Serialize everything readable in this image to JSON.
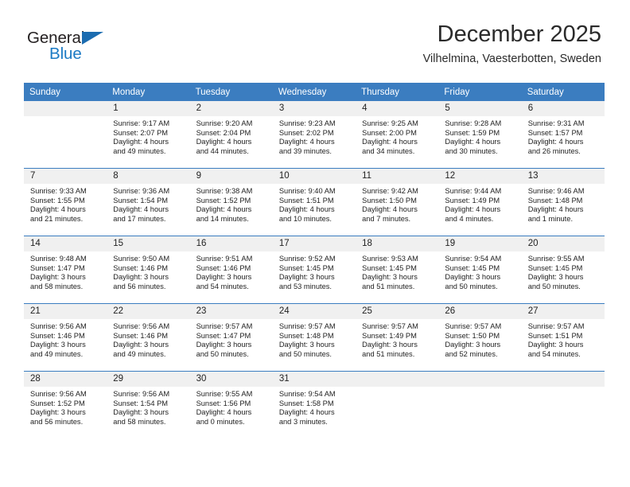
{
  "logo": {
    "word_one": "General",
    "word_two": "Blue",
    "triangle_color": "#1b6cb0",
    "blue_color": "#1b7ac4"
  },
  "header": {
    "title": "December 2025",
    "subtitle": "Vilhelmina, Vaesterbotten, Sweden",
    "header_bg": "#3b7dc0",
    "daynum_bg": "#f0f0f0"
  },
  "weekdays": [
    "Sunday",
    "Monday",
    "Tuesday",
    "Wednesday",
    "Thursday",
    "Friday",
    "Saturday"
  ],
  "weeks": [
    [
      {
        "day": "",
        "sunrise": "",
        "sunset": "",
        "daylight_line1": "",
        "daylight_line2": ""
      },
      {
        "day": "1",
        "sunrise": "Sunrise: 9:17 AM",
        "sunset": "Sunset: 2:07 PM",
        "daylight_line1": "Daylight: 4 hours",
        "daylight_line2": "and 49 minutes."
      },
      {
        "day": "2",
        "sunrise": "Sunrise: 9:20 AM",
        "sunset": "Sunset: 2:04 PM",
        "daylight_line1": "Daylight: 4 hours",
        "daylight_line2": "and 44 minutes."
      },
      {
        "day": "3",
        "sunrise": "Sunrise: 9:23 AM",
        "sunset": "Sunset: 2:02 PM",
        "daylight_line1": "Daylight: 4 hours",
        "daylight_line2": "and 39 minutes."
      },
      {
        "day": "4",
        "sunrise": "Sunrise: 9:25 AM",
        "sunset": "Sunset: 2:00 PM",
        "daylight_line1": "Daylight: 4 hours",
        "daylight_line2": "and 34 minutes."
      },
      {
        "day": "5",
        "sunrise": "Sunrise: 9:28 AM",
        "sunset": "Sunset: 1:59 PM",
        "daylight_line1": "Daylight: 4 hours",
        "daylight_line2": "and 30 minutes."
      },
      {
        "day": "6",
        "sunrise": "Sunrise: 9:31 AM",
        "sunset": "Sunset: 1:57 PM",
        "daylight_line1": "Daylight: 4 hours",
        "daylight_line2": "and 26 minutes."
      }
    ],
    [
      {
        "day": "7",
        "sunrise": "Sunrise: 9:33 AM",
        "sunset": "Sunset: 1:55 PM",
        "daylight_line1": "Daylight: 4 hours",
        "daylight_line2": "and 21 minutes."
      },
      {
        "day": "8",
        "sunrise": "Sunrise: 9:36 AM",
        "sunset": "Sunset: 1:54 PM",
        "daylight_line1": "Daylight: 4 hours",
        "daylight_line2": "and 17 minutes."
      },
      {
        "day": "9",
        "sunrise": "Sunrise: 9:38 AM",
        "sunset": "Sunset: 1:52 PM",
        "daylight_line1": "Daylight: 4 hours",
        "daylight_line2": "and 14 minutes."
      },
      {
        "day": "10",
        "sunrise": "Sunrise: 9:40 AM",
        "sunset": "Sunset: 1:51 PM",
        "daylight_line1": "Daylight: 4 hours",
        "daylight_line2": "and 10 minutes."
      },
      {
        "day": "11",
        "sunrise": "Sunrise: 9:42 AM",
        "sunset": "Sunset: 1:50 PM",
        "daylight_line1": "Daylight: 4 hours",
        "daylight_line2": "and 7 minutes."
      },
      {
        "day": "12",
        "sunrise": "Sunrise: 9:44 AM",
        "sunset": "Sunset: 1:49 PM",
        "daylight_line1": "Daylight: 4 hours",
        "daylight_line2": "and 4 minutes."
      },
      {
        "day": "13",
        "sunrise": "Sunrise: 9:46 AM",
        "sunset": "Sunset: 1:48 PM",
        "daylight_line1": "Daylight: 4 hours",
        "daylight_line2": "and 1 minute."
      }
    ],
    [
      {
        "day": "14",
        "sunrise": "Sunrise: 9:48 AM",
        "sunset": "Sunset: 1:47 PM",
        "daylight_line1": "Daylight: 3 hours",
        "daylight_line2": "and 58 minutes."
      },
      {
        "day": "15",
        "sunrise": "Sunrise: 9:50 AM",
        "sunset": "Sunset: 1:46 PM",
        "daylight_line1": "Daylight: 3 hours",
        "daylight_line2": "and 56 minutes."
      },
      {
        "day": "16",
        "sunrise": "Sunrise: 9:51 AM",
        "sunset": "Sunset: 1:46 PM",
        "daylight_line1": "Daylight: 3 hours",
        "daylight_line2": "and 54 minutes."
      },
      {
        "day": "17",
        "sunrise": "Sunrise: 9:52 AM",
        "sunset": "Sunset: 1:45 PM",
        "daylight_line1": "Daylight: 3 hours",
        "daylight_line2": "and 53 minutes."
      },
      {
        "day": "18",
        "sunrise": "Sunrise: 9:53 AM",
        "sunset": "Sunset: 1:45 PM",
        "daylight_line1": "Daylight: 3 hours",
        "daylight_line2": "and 51 minutes."
      },
      {
        "day": "19",
        "sunrise": "Sunrise: 9:54 AM",
        "sunset": "Sunset: 1:45 PM",
        "daylight_line1": "Daylight: 3 hours",
        "daylight_line2": "and 50 minutes."
      },
      {
        "day": "20",
        "sunrise": "Sunrise: 9:55 AM",
        "sunset": "Sunset: 1:45 PM",
        "daylight_line1": "Daylight: 3 hours",
        "daylight_line2": "and 50 minutes."
      }
    ],
    [
      {
        "day": "21",
        "sunrise": "Sunrise: 9:56 AM",
        "sunset": "Sunset: 1:46 PM",
        "daylight_line1": "Daylight: 3 hours",
        "daylight_line2": "and 49 minutes."
      },
      {
        "day": "22",
        "sunrise": "Sunrise: 9:56 AM",
        "sunset": "Sunset: 1:46 PM",
        "daylight_line1": "Daylight: 3 hours",
        "daylight_line2": "and 49 minutes."
      },
      {
        "day": "23",
        "sunrise": "Sunrise: 9:57 AM",
        "sunset": "Sunset: 1:47 PM",
        "daylight_line1": "Daylight: 3 hours",
        "daylight_line2": "and 50 minutes."
      },
      {
        "day": "24",
        "sunrise": "Sunrise: 9:57 AM",
        "sunset": "Sunset: 1:48 PM",
        "daylight_line1": "Daylight: 3 hours",
        "daylight_line2": "and 50 minutes."
      },
      {
        "day": "25",
        "sunrise": "Sunrise: 9:57 AM",
        "sunset": "Sunset: 1:49 PM",
        "daylight_line1": "Daylight: 3 hours",
        "daylight_line2": "and 51 minutes."
      },
      {
        "day": "26",
        "sunrise": "Sunrise: 9:57 AM",
        "sunset": "Sunset: 1:50 PM",
        "daylight_line1": "Daylight: 3 hours",
        "daylight_line2": "and 52 minutes."
      },
      {
        "day": "27",
        "sunrise": "Sunrise: 9:57 AM",
        "sunset": "Sunset: 1:51 PM",
        "daylight_line1": "Daylight: 3 hours",
        "daylight_line2": "and 54 minutes."
      }
    ],
    [
      {
        "day": "28",
        "sunrise": "Sunrise: 9:56 AM",
        "sunset": "Sunset: 1:52 PM",
        "daylight_line1": "Daylight: 3 hours",
        "daylight_line2": "and 56 minutes."
      },
      {
        "day": "29",
        "sunrise": "Sunrise: 9:56 AM",
        "sunset": "Sunset: 1:54 PM",
        "daylight_line1": "Daylight: 3 hours",
        "daylight_line2": "and 58 minutes."
      },
      {
        "day": "30",
        "sunrise": "Sunrise: 9:55 AM",
        "sunset": "Sunset: 1:56 PM",
        "daylight_line1": "Daylight: 4 hours",
        "daylight_line2": "and 0 minutes."
      },
      {
        "day": "31",
        "sunrise": "Sunrise: 9:54 AM",
        "sunset": "Sunset: 1:58 PM",
        "daylight_line1": "Daylight: 4 hours",
        "daylight_line2": "and 3 minutes."
      },
      {
        "day": "",
        "sunrise": "",
        "sunset": "",
        "daylight_line1": "",
        "daylight_line2": ""
      },
      {
        "day": "",
        "sunrise": "",
        "sunset": "",
        "daylight_line1": "",
        "daylight_line2": ""
      },
      {
        "day": "",
        "sunrise": "",
        "sunset": "",
        "daylight_line1": "",
        "daylight_line2": ""
      }
    ]
  ]
}
